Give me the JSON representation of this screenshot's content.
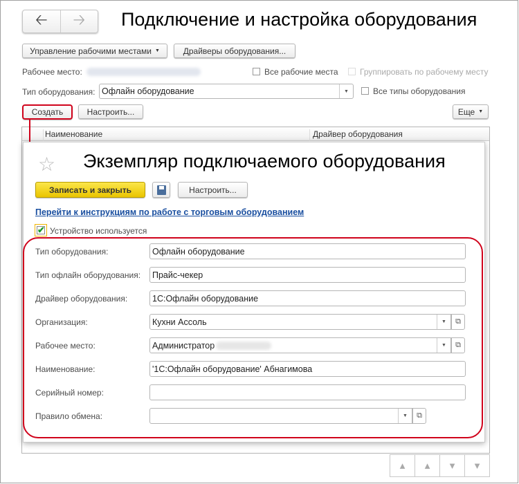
{
  "main": {
    "title": "Подключение и настройка оборудования",
    "buttons": {
      "workplaces": "Управление рабочими местами",
      "drivers": "Драйверы оборудования...",
      "create": "Создать",
      "configure": "Настроить...",
      "more": "Еще"
    },
    "workplace_label": "Рабочее место:",
    "all_workplaces": "Все рабочие места",
    "group_by_workplace": "Группировать по рабочему месту",
    "equipment_type_label": "Тип оборудования:",
    "equipment_type_value": "Офлайн оборудование",
    "all_types": "Все типы оборудования",
    "table": {
      "columns": [
        "Наименование",
        "Драйвер оборудования"
      ]
    }
  },
  "dialog": {
    "title": "Экземпляр подключаемого оборудования",
    "save_close": "Записать и закрыть",
    "configure": "Настроить...",
    "instructions_link": "Перейти к инструкциям по работе с торговым оборудованием",
    "device_used": "Устройство используется",
    "device_used_checked": true,
    "fields": [
      {
        "label": "Тип оборудования:",
        "value": "Офлайн оборудование"
      },
      {
        "label": "Тип офлайн оборудования:",
        "value": "Прайс-чекер"
      },
      {
        "label": "Драйвер оборудования:",
        "value": "1С:Офлайн оборудование"
      },
      {
        "label": "Организация:",
        "value": "Кухни Ассоль"
      },
      {
        "label": "Рабочее место:",
        "value": "Администратор"
      },
      {
        "label": "Наименование:",
        "value": "'1С:Офлайн оборудование' Абнагимова"
      },
      {
        "label": "Серийный номер:",
        "value": ""
      },
      {
        "label": "Правило обмена:",
        "value": ""
      }
    ]
  },
  "colors": {
    "highlight": "#d0021b",
    "primary_button": "#f5d90a",
    "link": "#1a4fa0"
  }
}
